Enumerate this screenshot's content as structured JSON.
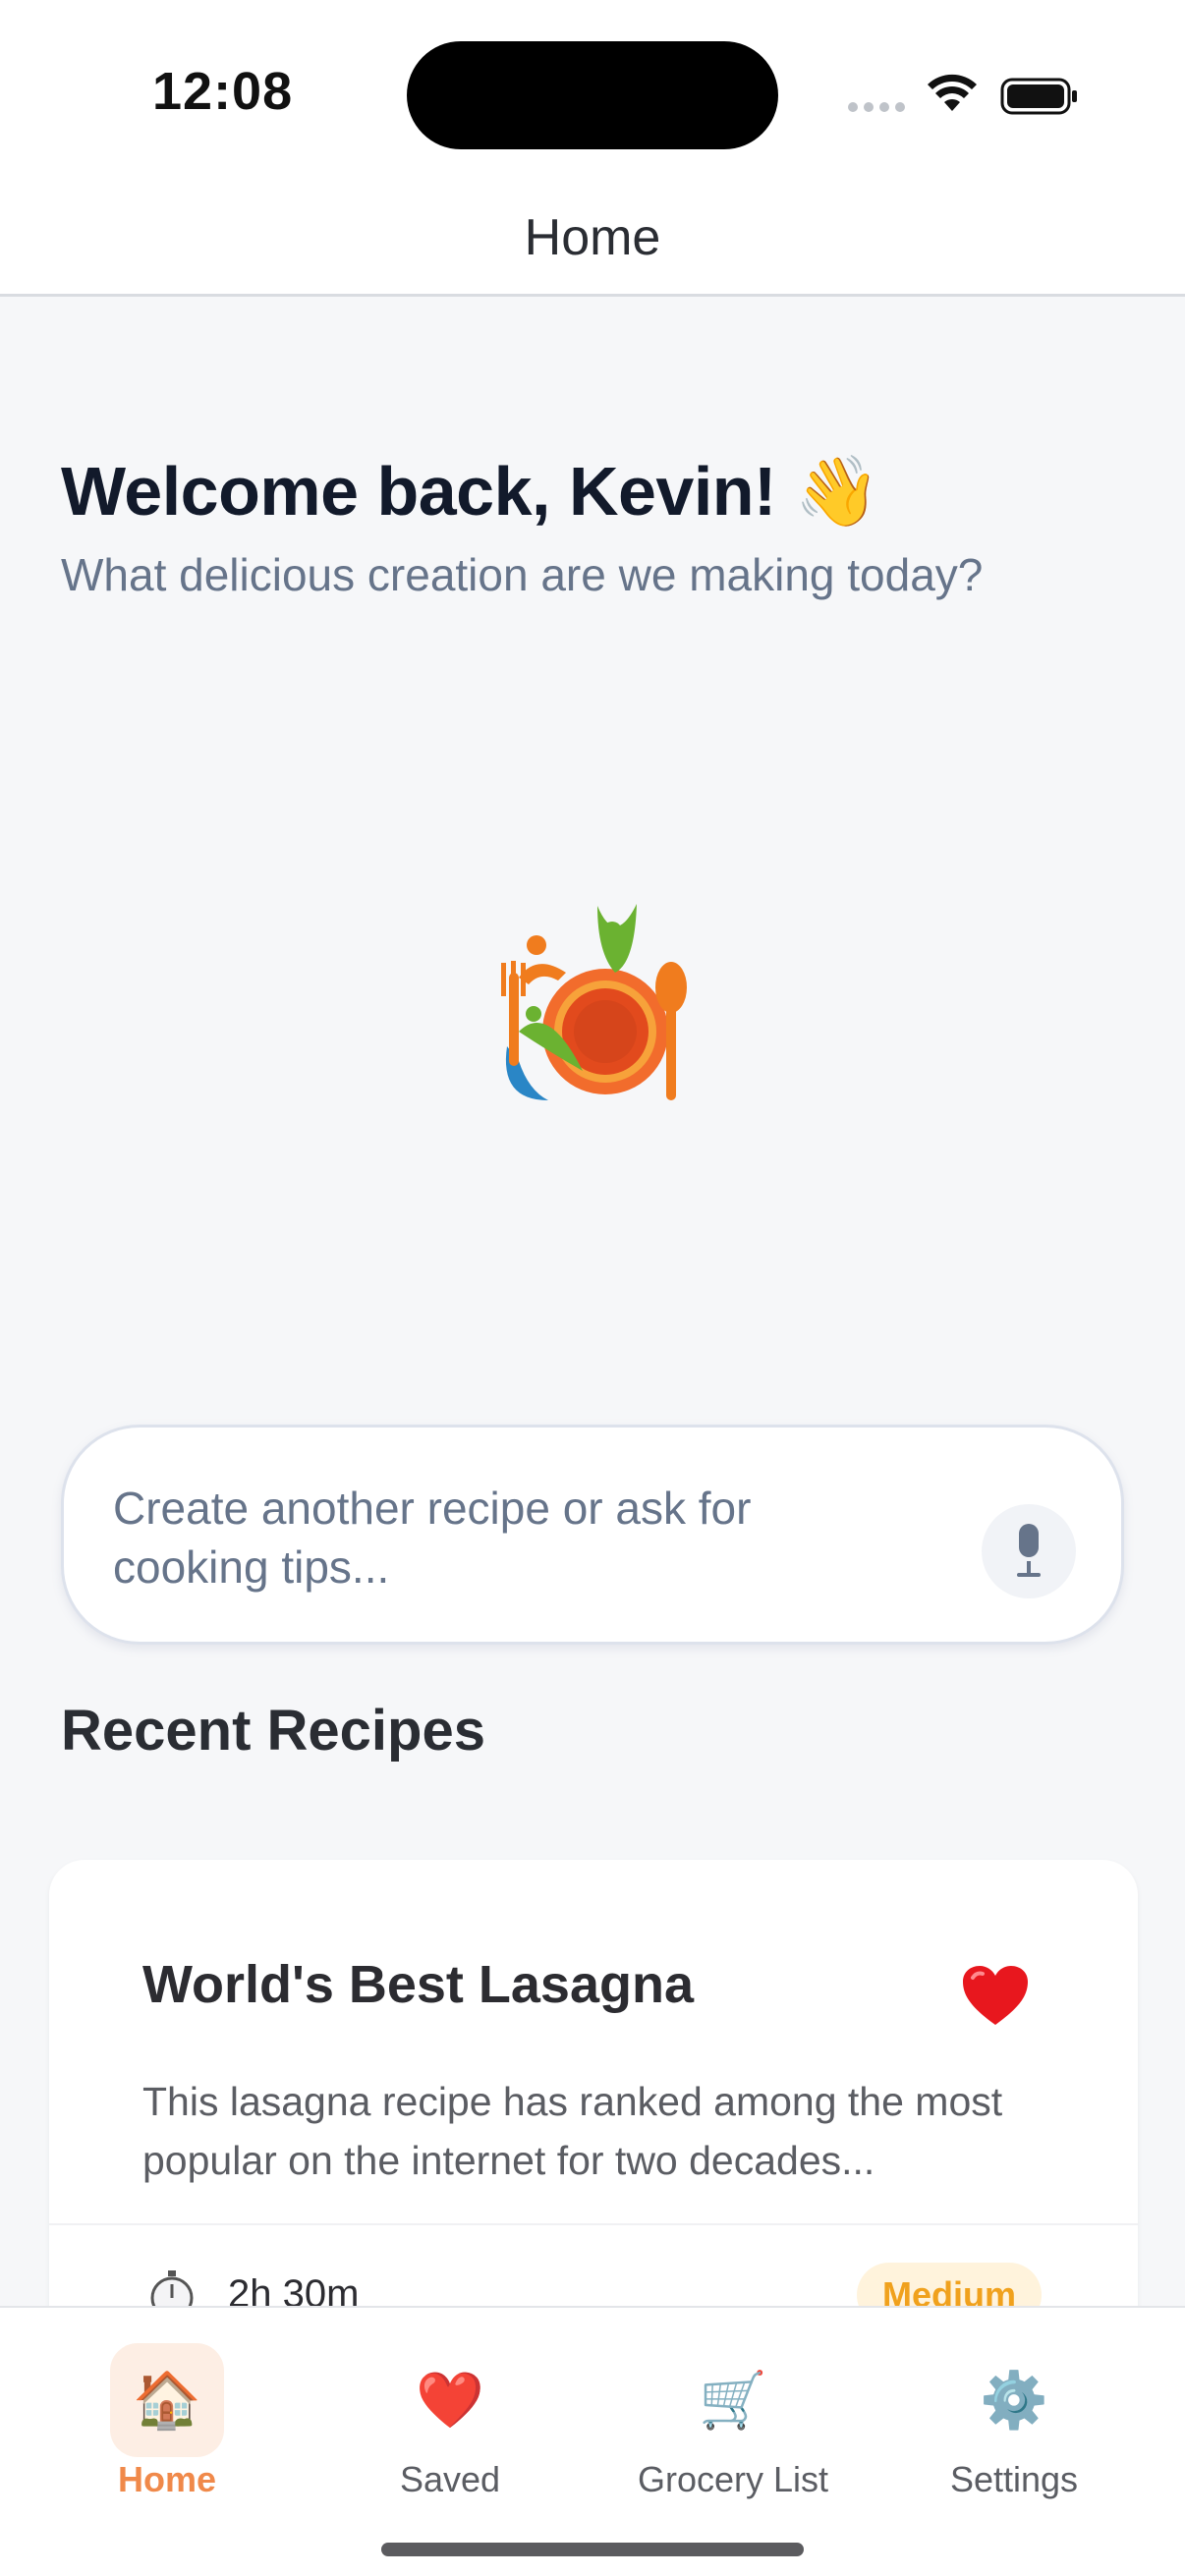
{
  "status_bar": {
    "time": "12:08"
  },
  "nav": {
    "title": "Home"
  },
  "welcome": {
    "title": "Welcome back, Kevin! 👋",
    "subtitle": "What delicious creation are we making today?"
  },
  "prompt": {
    "placeholder": "Create another recipe or ask for cooking tips...",
    "mic_icon": "microphone-icon"
  },
  "recent": {
    "title": "Recent Recipes",
    "recipes": [
      {
        "name": "World's Best Lasagna",
        "description": "This lasagna recipe has ranked among the most popular on the internet for two decades...",
        "time": "2h 30m",
        "difficulty": "Medium",
        "favorite_icon": "heart-icon",
        "time_icon": "stopwatch-icon"
      }
    ]
  },
  "tabs": [
    {
      "label": "Home",
      "icon": "🏠",
      "active": true
    },
    {
      "label": "Saved",
      "icon": "❤️",
      "active": false
    },
    {
      "label": "Grocery List",
      "icon": "🛒",
      "active": false
    },
    {
      "label": "Settings",
      "icon": "⚙️",
      "active": false
    }
  ],
  "colors": {
    "accent": "#f0894a",
    "badge_text": "#f0a11d",
    "badge_bg": "#fff3dc",
    "heading": "#121a2b",
    "muted": "#66748a"
  }
}
